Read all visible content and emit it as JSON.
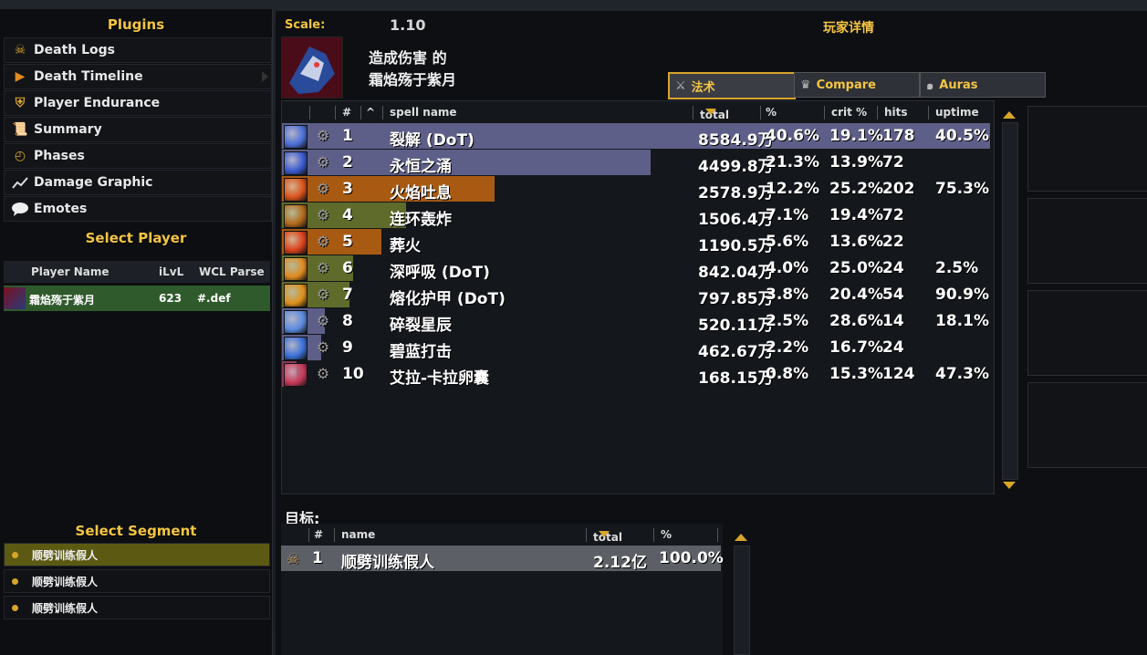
{
  "left_panel": {
    "plugins_title": "Plugins",
    "plugins": [
      {
        "label": "Death Logs",
        "icon": "skull-crossbones-icon"
      },
      {
        "label": "Death Timeline",
        "icon": "play-arrow-icon"
      },
      {
        "label": "Player Endurance",
        "icon": "shield-icon"
      },
      {
        "label": "Summary",
        "icon": "scroll-icon"
      },
      {
        "label": "Phases",
        "icon": "clock-icon"
      },
      {
        "label": "Damage Graphic",
        "icon": "line-chart-icon"
      },
      {
        "label": "Emotes",
        "icon": "speech-bubble-icon"
      }
    ],
    "select_player_title": "Select Player",
    "player_columns": {
      "name": "Player Name",
      "ilvl": "iLvL",
      "wcl": "WCL Parse"
    },
    "players": [
      {
        "name": "霜焰殇于紫月",
        "ilvl": "623",
        "wcl": "#.def"
      }
    ],
    "select_segment_title": "Select Segment",
    "segments": [
      {
        "label": "顺劈训练假人",
        "selected": true
      },
      {
        "label": "顺劈训练假人",
        "selected": false
      },
      {
        "label": "顺劈训练假人",
        "selected": false
      }
    ]
  },
  "main_panel": {
    "scale_label": "Scale:",
    "scale_value": "1.10",
    "details_title": "玩家详情",
    "damage_title_line1": "造成伤害 的",
    "damage_title_line2": "霜焰殇于紫月",
    "tabs": [
      {
        "label": "法术",
        "icon": "crossed-swords-icon",
        "active": true
      },
      {
        "label": "Compare",
        "icon": "crown-icon",
        "active": false
      },
      {
        "label": "Auras",
        "icon": "swirl-icon",
        "active": false
      }
    ],
    "spell_columns": {
      "num": "#",
      "sort": "^",
      "name": "spell name",
      "total": "total",
      "pct": "%",
      "crit": "crit %",
      "hits": "hits",
      "uptime": "uptime"
    },
    "spells": [
      {
        "num": "1",
        "name": "裂解 (DoT)",
        "total": "8584.9万",
        "pct": "40.6%",
        "crit": "19.1%",
        "hits": "178",
        "uptime": "40.5%",
        "bar_pct": 100,
        "bar_color": "#5d5f88",
        "icon_color": "#4a6fd8"
      },
      {
        "num": "2",
        "name": "永恒之涌",
        "total": "4499.8万",
        "pct": "21.3%",
        "crit": "13.9%",
        "hits": "72",
        "uptime": "",
        "bar_pct": 52,
        "bar_color": "#5d5f88",
        "icon_color": "#3a5bd0"
      },
      {
        "num": "3",
        "name": "火焰吐息",
        "total": "2578.9万",
        "pct": "12.2%",
        "crit": "25.2%",
        "hits": "202",
        "uptime": "75.3%",
        "bar_pct": 30,
        "bar_color": "#a85a12",
        "icon_color": "#d8521a"
      },
      {
        "num": "4",
        "name": "连环轰炸",
        "total": "1506.4万",
        "pct": "7.1%",
        "crit": "19.4%",
        "hits": "72",
        "uptime": "",
        "bar_pct": 17.5,
        "bar_color": "#5f6b2a",
        "icon_color": "#b26a1a"
      },
      {
        "num": "5",
        "name": "葬火",
        "total": "1190.5万",
        "pct": "5.6%",
        "crit": "13.6%",
        "hits": "22",
        "uptime": "",
        "bar_pct": 14,
        "bar_color": "#a85a12",
        "icon_color": "#d8401a"
      },
      {
        "num": "6",
        "name": "深呼吸 (DoT)",
        "total": "842.04万",
        "pct": "4.0%",
        "crit": "25.0%",
        "hits": "24",
        "uptime": "2.5%",
        "bar_pct": 10,
        "bar_color": "#5f6b2a",
        "icon_color": "#e08a20"
      },
      {
        "num": "7",
        "name": "熔化护甲 (DoT)",
        "total": "797.85万",
        "pct": "3.8%",
        "crit": "20.4%",
        "hits": "54",
        "uptime": "90.9%",
        "bar_pct": 9.5,
        "bar_color": "#5f6b2a",
        "icon_color": "#e0901a"
      },
      {
        "num": "8",
        "name": "碎裂星辰",
        "total": "520.11万",
        "pct": "2.5%",
        "crit": "28.6%",
        "hits": "14",
        "uptime": "18.1%",
        "bar_pct": 6,
        "bar_color": "#5d5f88",
        "icon_color": "#5a8ae0"
      },
      {
        "num": "9",
        "name": "碧蓝打击",
        "total": "462.67万",
        "pct": "2.2%",
        "crit": "16.7%",
        "hits": "24",
        "uptime": "",
        "bar_pct": 5.5,
        "bar_color": "#5d5f88",
        "icon_color": "#3a70d8"
      },
      {
        "num": "10",
        "name": "艾拉-卡拉卵囊",
        "total": "168.15万",
        "pct": "0.8%",
        "crit": "15.3%",
        "hits": "124",
        "uptime": "47.3%",
        "bar_pct": 2,
        "bar_color": "#8a3a5a",
        "icon_color": "#c83a5a"
      }
    ],
    "target_label": "目标:",
    "target_columns": {
      "num": "#",
      "name": "name",
      "total": "total",
      "pct": "%"
    },
    "targets": [
      {
        "num": "1",
        "name": "顺劈训练假人",
        "total": "2.12亿",
        "pct": "100.0%",
        "icon": "skull-icon"
      }
    ]
  }
}
